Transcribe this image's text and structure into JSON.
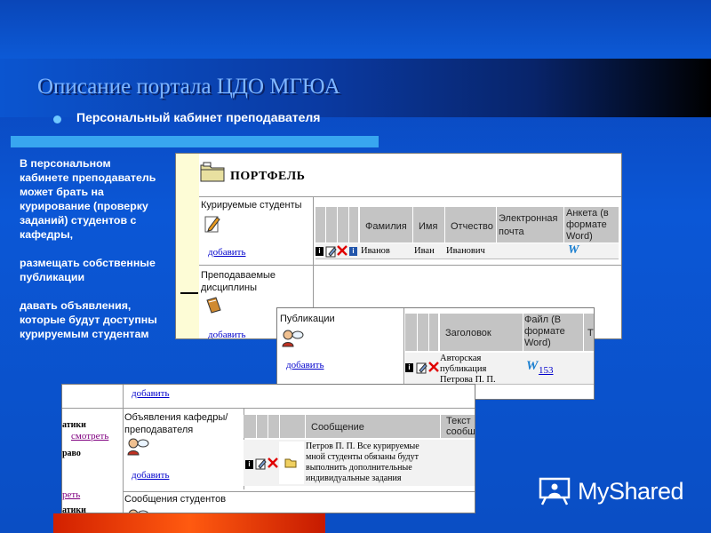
{
  "slide": {
    "title": "Описание портала ЦДО МГЮА",
    "subtitle": "Персональный кабинет преподавателя",
    "description": [
      "В персональном кабинете преподаватель может брать на курирование (проверку заданий) студентов с кафедры,",
      "размещать собственные публикации",
      "давать объявления, которые будут доступны курируемым студентам"
    ],
    "logo": "MyShared"
  },
  "portfolio": {
    "title": "ПОРТФЕЛЬ",
    "students_section": "Курируемые студенты",
    "add_link": "добавить",
    "disciplines_section": "Преподаваемые дисциплины",
    "add_link2": "добавить",
    "columns": [
      "Фамилия",
      "Имя",
      "Отчество",
      "Электронная почта",
      "Анкета (в формате Word)"
    ],
    "row": {
      "last_name": "Иванов",
      "first_name": "Иван",
      "patronymic": "Иванович",
      "email": ""
    }
  },
  "publications": {
    "section": "Публикации",
    "add_link": "добавить",
    "columns": [
      "Заголовок",
      "Файл (В формате Word)",
      "Т"
    ],
    "row": {
      "title": "Авторская публикация Петрова П. П.",
      "file_num": "153"
    }
  },
  "announcements": {
    "top_add_link": "добавить",
    "left_fragments": [
      "атики",
      "смотреть",
      "раво",
      "реть",
      "атики"
    ],
    "section": "Объявления кафедры/преподавателя",
    "add_link": "добавить",
    "columns": [
      "Сообщение",
      "Текст сообще"
    ],
    "row": {
      "message": "Петров П. П. Все курируемые мной студенты обязаны будут выполнить дополнительные индивидуальные задания"
    },
    "student_messages": "Сообщения студентов"
  }
}
